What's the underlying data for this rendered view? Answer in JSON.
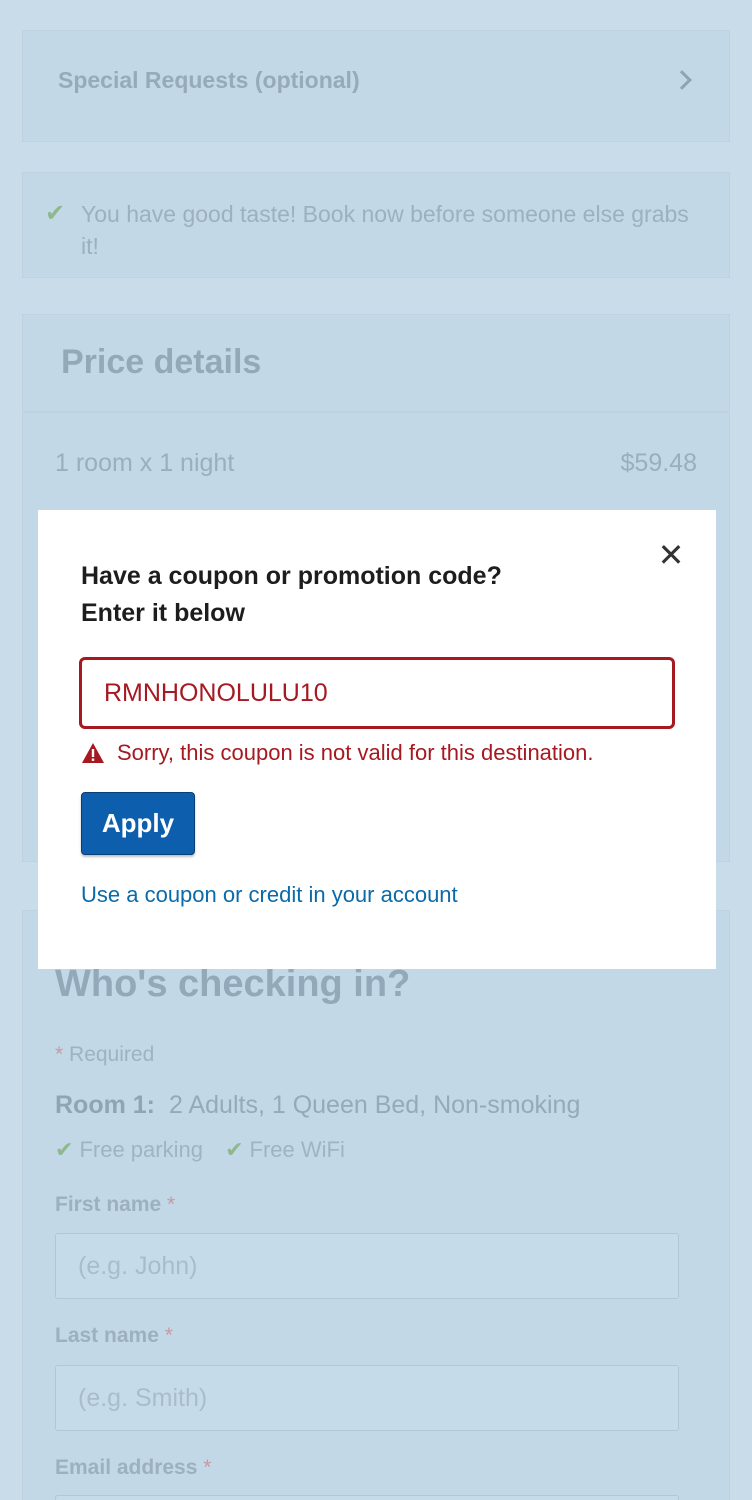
{
  "special_requests": {
    "label": "Special Requests (optional)"
  },
  "taste_banner": {
    "text": "You have good taste! Book now before someone else grabs it!"
  },
  "price_details": {
    "title": "Price details",
    "line_label": "1 room x 1 night",
    "line_amount": "$59.48"
  },
  "checkin": {
    "title": "Who's checking in?",
    "required_star": "*",
    "required_text": " Required",
    "room_label": "Room 1:",
    "room_details": "2 Adults, 1 Queen Bed, Non-smoking",
    "amenities": [
      "Free parking",
      "Free WiFi"
    ],
    "first_name_label": "First name",
    "first_name_placeholder": "(e.g. John)",
    "last_name_label": "Last name",
    "last_name_placeholder": "(e.g. Smith)",
    "email_label": "Email address",
    "star": "*"
  },
  "modal": {
    "heading_line1": "Have a coupon or promotion code?",
    "heading_line2": "Enter it below",
    "close_glyph": "✕",
    "coupon_value": "RMNHONOLULU10",
    "error_text": "Sorry, this coupon is not valid for this destination.",
    "apply_label": "Apply",
    "account_link": "Use a coupon or credit in your account"
  },
  "colors": {
    "error": "#a61920",
    "primary_button": "#0d5fae",
    "link": "#0b6aa8",
    "overlay_bg": "#c8dcea"
  },
  "icons": [
    "chevron-right-icon",
    "check-icon",
    "warning-icon",
    "close-icon"
  ]
}
